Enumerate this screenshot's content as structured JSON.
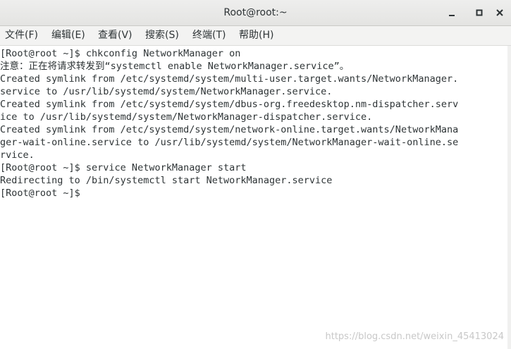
{
  "window": {
    "title": "Root@root:~"
  },
  "menu": {
    "items": [
      {
        "label": "文件(F)"
      },
      {
        "label": "编辑(E)"
      },
      {
        "label": "查看(V)"
      },
      {
        "label": "搜索(S)"
      },
      {
        "label": "终端(T)"
      },
      {
        "label": "帮助(H)"
      }
    ]
  },
  "terminal": {
    "lines": [
      "[Root@root ~]$ chkconfig NetworkManager on",
      "注意：正在将请求转发到“systemctl enable NetworkManager.service”。",
      "Created symlink from /etc/systemd/system/multi-user.target.wants/NetworkManager.",
      "service to /usr/lib/systemd/system/NetworkManager.service.",
      "Created symlink from /etc/systemd/system/dbus-org.freedesktop.nm-dispatcher.serv",
      "ice to /usr/lib/systemd/system/NetworkManager-dispatcher.service.",
      "Created symlink from /etc/systemd/system/network-online.target.wants/NetworkMana",
      "ger-wait-online.service to /usr/lib/systemd/system/NetworkManager-wait-online.se",
      "rvice.",
      "[Root@root ~]$ service NetworkManager start",
      "Redirecting to /bin/systemctl start NetworkManager.service",
      "[Root@root ~]$ "
    ]
  },
  "watermark": "https://blog.csdn.net/weixin_45413024",
  "icons": {
    "minimize": "minimize-icon",
    "maximize": "maximize-icon",
    "close": "close-icon"
  }
}
